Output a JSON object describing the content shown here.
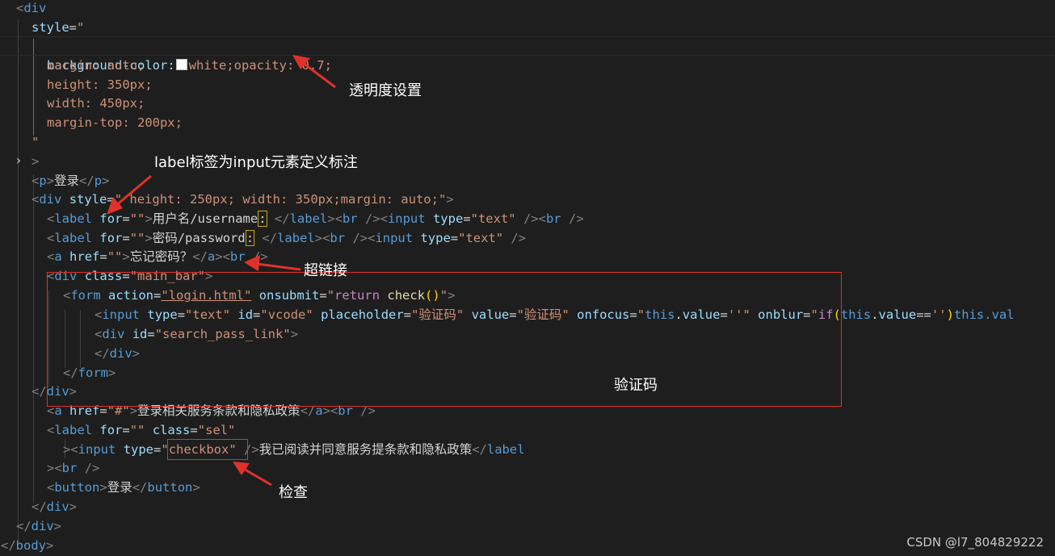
{
  "code_lines": {
    "l0_tag": "div",
    "l1_attr": "style",
    "l2_prop": "background-color:",
    "l2_val": "white;opacity: 0.7;",
    "l3": "margin: auto;",
    "l4": "height: 350px;",
    "l5": "width: 450px;",
    "l6": "margin-top: 200px;",
    "l7": "\"",
    "l8": ">",
    "l9_tag": "p",
    "l9_text": "登录",
    "l10_tag": "div",
    "l10_attr": "style",
    "l10_val": "\" height: 250px; width: 350px;margin: auto;\"",
    "l11_tag": "label",
    "l11_for": "for",
    "l11_for_val": "\"\"",
    "l11_text": "用户名/username",
    "l11_colon": ":",
    "l11_br": "br",
    "l11_input": "input",
    "l11_type": "type",
    "l11_type_val": "\"text\"",
    "l12_text": "密码/password",
    "l12_colon": ":",
    "l13_tag": "a",
    "l13_href": "href",
    "l13_href_val": "\"\"",
    "l13_text": "忘记密码？",
    "l14_tag": "div",
    "l14_class": "class",
    "l14_class_val": "\"main_bar\"",
    "l15_tag": "form",
    "l15_action": "action",
    "l15_action_val": "\"login.html\"",
    "l15_onsubmit": "onsubmit",
    "l15_return": "return",
    "l15_check": "check",
    "l16_tag": "input",
    "l16_id": "id",
    "l16_id_val": "\"vcode\"",
    "l16_placeholder": "placeholder",
    "l16_placeholder_val": "\"验证码\"",
    "l16_value": "value",
    "l16_value_val": "\"验证码\"",
    "l16_onfocus": "onfocus",
    "l16_this": "this",
    "l16_value_prop": "value",
    "l16_empty": "''",
    "l16_onblur": "onblur",
    "l16_if": "if",
    "l16_tail": "this.val",
    "l17_id_val": "\"search_pass_link\"",
    "l20_tag": "div",
    "l21_href_val": "\"#\"",
    "l21_text": "登录相关服务条款和隐私政策",
    "l22_class_val": "\"sel\"",
    "l23_checkbox": "\"checkbox\"",
    "l23_text": "我已阅读并同意服务提条款和隐私政策",
    "l25_tag": "button",
    "l25_text": "登录",
    "l28_tag": "body"
  },
  "annotations": {
    "opacity": "透明度设置",
    "label": "label标签为input元素定义标注",
    "hyperlink": "超链接",
    "captcha": "验证码",
    "check": "检查"
  },
  "watermark": "CSDN @l7_804829222",
  "colors": {
    "background": "#1e1e1e",
    "tag": "#569cd6",
    "attribute": "#9cdcfe",
    "string": "#ce9178",
    "annotation_red": "#e0322b"
  }
}
